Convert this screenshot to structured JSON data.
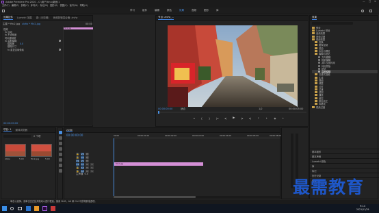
{
  "app": {
    "title": "Adobe Premiere Pro 2020 - C:\\用户\\tinu\\桌面\\1",
    "menu": [
      "文件(F)",
      "编辑(E)",
      "剪辑(C)",
      "序列(S)",
      "标记(M)",
      "图形(G)",
      "视图(V)",
      "窗口(W)",
      "帮助(H)"
    ],
    "workspaces": [
      "学习",
      "组件",
      "编辑",
      "颜色",
      "效果",
      "音频",
      "图形",
      "库"
    ],
    "active_workspace": "效果"
  },
  "effect_controls": {
    "tabs": [
      "效果控件",
      "Lumetri 范围",
      "源: (无剪辑)",
      "音频剪辑混合器: zlvfw"
    ],
    "clip_label": "主要 * f9c2.jpg",
    "seq_label": "zlvfw * f9c2.jpg",
    "timecode_start": "00:00",
    "timecode_end": "00:00:05",
    "rows": [
      {
        "label": "视频",
        "type": "header"
      },
      {
        "label": "fx 运动",
        "type": "item"
      },
      {
        "label": "fx 不透明度",
        "type": "item"
      },
      {
        "label": "时间重映射",
        "type": "item"
      },
      {
        "label": "fx 高斯模糊",
        "type": "item"
      },
      {
        "label": "模糊度",
        "value": "0.0",
        "type": "sub"
      },
      {
        "label": "模糊尺寸",
        "type": "sub"
      },
      {
        "label": "fx 重复边缘像素",
        "type": "item"
      }
    ],
    "clip_name": "f9c2.jpg",
    "footer_timecode": "00:00:00:00"
  },
  "program": {
    "title": "节目: zlvfw_...",
    "timecode": "00:00:00:00",
    "fit_label": "适合",
    "scale_label": "1/2",
    "duration": "00:00:05:00"
  },
  "project": {
    "tabs": [
      "项目: 1",
      "媒体浏览器"
    ],
    "search_placeholder": "",
    "count": "2 个项",
    "items": [
      {
        "name": "zlvfw",
        "duration": "5:00"
      },
      {
        "name": "f9c2.jpg",
        "duration": "5:00"
      }
    ]
  },
  "timeline": {
    "title": "zlvfw",
    "timecode": "00:00:00:00",
    "ruler": [
      "00:00",
      "00:00:01:00",
      "00:00:02:00",
      "00:00:03:00",
      "00:00:04:00",
      "00:00:05:00",
      "00:00:06:00"
    ],
    "tracks_video": [
      "V3",
      "V2",
      "V1"
    ],
    "tracks_audio": [
      "A1",
      "A2",
      "A3"
    ],
    "master_label": "主声道",
    "master_value": "0.0",
    "clip_label": "f9c2.jpg"
  },
  "effects_panel": {
    "title": "效果",
    "search_placeholder": "",
    "items": [
      {
        "label": "预设",
        "level": 0
      },
      {
        "label": "Lumetri 预设",
        "level": 0
      },
      {
        "label": "音频效果",
        "level": 0
      },
      {
        "label": "音频过渡",
        "level": 0
      },
      {
        "label": "视频效果",
        "level": 0
      },
      {
        "label": "变换",
        "level": 1
      },
      {
        "label": "图像控制",
        "level": 1
      },
      {
        "label": "扭曲",
        "level": 1
      },
      {
        "label": "杂色与颗粒",
        "level": 1
      },
      {
        "label": "模糊与锐化",
        "level": 1
      },
      {
        "label": "方向模糊",
        "level": 2
      },
      {
        "label": "相机模糊",
        "level": 2
      },
      {
        "label": "减少交错闪烁",
        "level": 2
      },
      {
        "label": "钝化蒙版",
        "level": 2
      },
      {
        "label": "锐化",
        "level": 2
      },
      {
        "label": "高斯模糊",
        "level": 2,
        "selected": true
      },
      {
        "label": "沉浸式视频",
        "level": 1
      },
      {
        "label": "生成",
        "level": 1
      },
      {
        "label": "视频",
        "level": 1
      },
      {
        "label": "调整",
        "level": 1
      },
      {
        "label": "过时",
        "level": 1
      },
      {
        "label": "过渡",
        "level": 1
      },
      {
        "label": "透视",
        "level": 1
      },
      {
        "label": "通道",
        "level": 1
      },
      {
        "label": "键控",
        "level": 1
      },
      {
        "label": "颜色校正",
        "level": 1
      },
      {
        "label": "风格化",
        "level": 1
      },
      {
        "label": "视频过渡",
        "level": 0
      }
    ],
    "bottom_panels": [
      "基本图形",
      "基本声音",
      "Lumetri 颜色",
      "库",
      "标记",
      "历史记录",
      "信息"
    ]
  },
  "statusbar": {
    "text": "单击以选择，或单击空白处并拖动以进行框选。使用 Shift、Alt 和 Ctrl 可获得其他选项。"
  },
  "taskbar": {
    "time": "9:14",
    "date": "2021/11/29"
  },
  "watermark": "最需教育",
  "colors": {
    "accent": "#4a90e2",
    "clip_pink": "#d48fd6",
    "watermark_blue": "#1e57c9"
  }
}
